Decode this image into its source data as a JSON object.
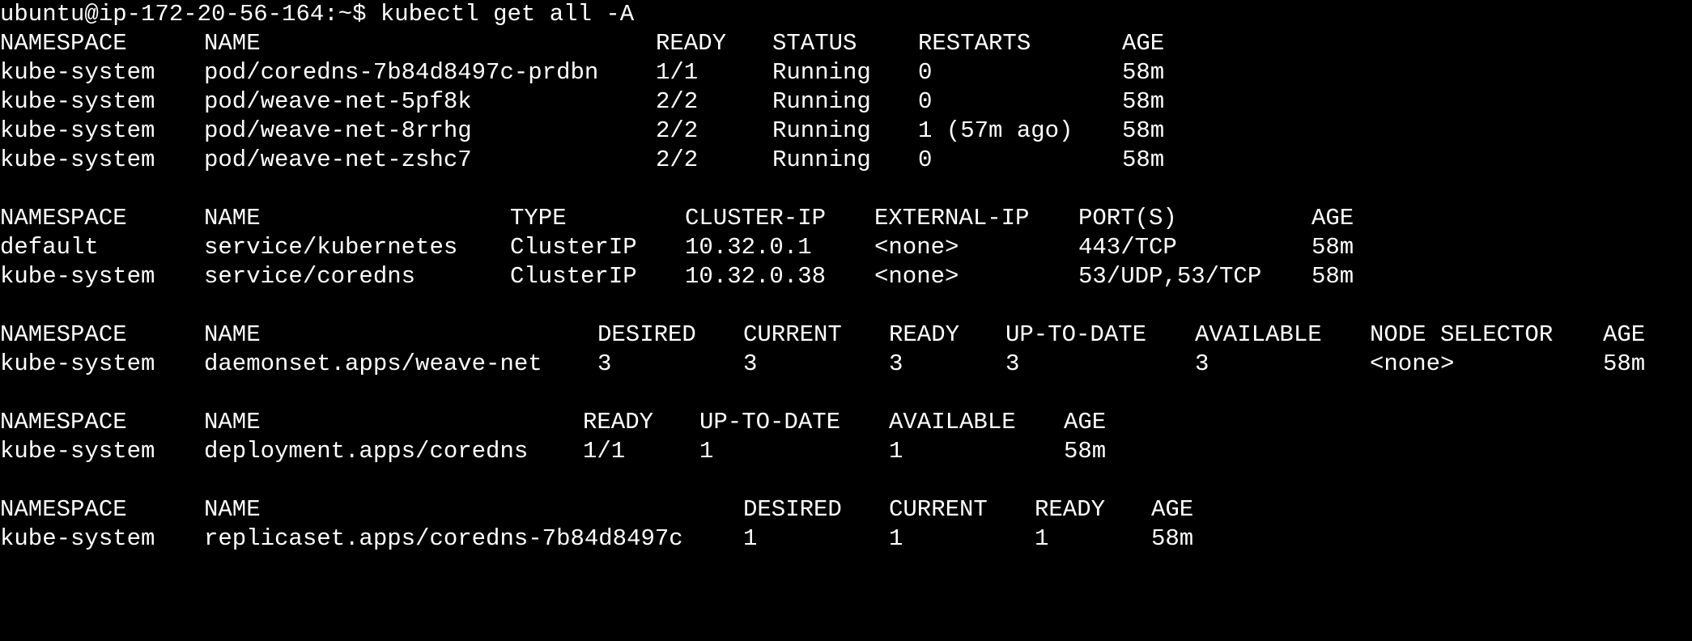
{
  "terminal": {
    "prompt": "ubuntu@ip-172-20-56-164:~$ kubectl get all -A",
    "pods": {
      "headers": [
        "NAMESPACE",
        "NAME",
        "READY",
        "STATUS",
        "RESTARTS",
        "AGE"
      ],
      "rows": [
        [
          "kube-system",
          "pod/coredns-7b84d8497c-prdbn",
          "1/1",
          "Running",
          "0",
          "58m"
        ],
        [
          "kube-system",
          "pod/weave-net-5pf8k",
          "2/2",
          "Running",
          "0",
          "58m"
        ],
        [
          "kube-system",
          "pod/weave-net-8rrhg",
          "2/2",
          "Running",
          "1 (57m ago)",
          "58m"
        ],
        [
          "kube-system",
          "pod/weave-net-zshc7",
          "2/2",
          "Running",
          "0",
          "58m"
        ]
      ]
    },
    "services": {
      "headers": [
        "NAMESPACE",
        "NAME",
        "TYPE",
        "CLUSTER-IP",
        "EXTERNAL-IP",
        "PORT(S)",
        "AGE"
      ],
      "rows": [
        [
          "default",
          "service/kubernetes",
          "ClusterIP",
          "10.32.0.1",
          "<none>",
          "443/TCP",
          "58m"
        ],
        [
          "kube-system",
          "service/coredns",
          "ClusterIP",
          "10.32.0.38",
          "<none>",
          "53/UDP,53/TCP",
          "58m"
        ]
      ]
    },
    "daemonsets": {
      "headers": [
        "NAMESPACE",
        "NAME",
        "DESIRED",
        "CURRENT",
        "READY",
        "UP-TO-DATE",
        "AVAILABLE",
        "NODE SELECTOR",
        "AGE"
      ],
      "rows": [
        [
          "kube-system",
          "daemonset.apps/weave-net",
          "3",
          "3",
          "3",
          "3",
          "3",
          "<none>",
          "58m"
        ]
      ]
    },
    "deployments": {
      "headers": [
        "NAMESPACE",
        "NAME",
        "READY",
        "UP-TO-DATE",
        "AVAILABLE",
        "AGE"
      ],
      "rows": [
        [
          "kube-system",
          "deployment.apps/coredns",
          "1/1",
          "1",
          "1",
          "58m"
        ]
      ]
    },
    "replicasets": {
      "headers": [
        "NAMESPACE",
        "NAME",
        "DESIRED",
        "CURRENT",
        "READY",
        "AGE"
      ],
      "rows": [
        [
          "kube-system",
          "replicaset.apps/coredns-7b84d8497c",
          "1",
          "1",
          "1",
          "58m"
        ]
      ]
    }
  }
}
